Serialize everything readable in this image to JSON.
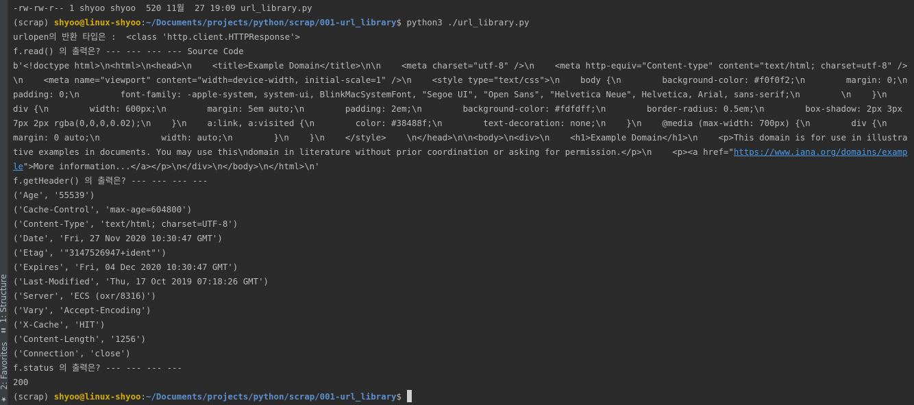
{
  "sidebar": {
    "structure_tab": "1: Structure",
    "favorites_tab": "2: Favorites"
  },
  "terminal": {
    "ls_line": "-rw-rw-r-- 1 shyoo shyoo  520 11월  27 19:09 url_library.py",
    "prompt": {
      "env": "(scrap) ",
      "user": "shyoo@linux-shyoo",
      "colon": ":",
      "path": "~/Documents/projects/python/scrap/001-url_library",
      "dollar": "$ "
    },
    "command": "python3 ./url_library.py",
    "output": {
      "return_type": "urlopen의 반환 타입은 :  <class 'http.client.HTTPResponse'>",
      "read_header": "f.read() 의 출력은? --- --- --- --- Source Code",
      "html_before_link": "b'<!doctype html>\\n<html>\\n<head>\\n    <title>Example Domain</title>\\n\\n    <meta charset=\"utf-8\" />\\n    <meta http-equiv=\"Content-type\" content=\"text/html; charset=utf-8\" />\\n    <meta name=\"viewport\" content=\"width=device-width, initial-scale=1\" />\\n    <style type=\"text/css\">\\n    body {\\n        background-color: #f0f0f2;\\n        margin: 0;\\n        padding: 0;\\n        font-family: -apple-system, system-ui, BlinkMacSystemFont, \"Segoe UI\", \"Open Sans\", \"Helvetica Neue\", Helvetica, Arial, sans-serif;\\n        \\n    }\\n    div {\\n        width: 600px;\\n        margin: 5em auto;\\n        padding: 2em;\\n        background-color: #fdfdff;\\n        border-radius: 0.5em;\\n        box-shadow: 2px 3px 7px 2px rgba(0,0,0,0.02);\\n    }\\n    a:link, a:visited {\\n        color: #38488f;\\n        text-decoration: none;\\n    }\\n    @media (max-width: 700px) {\\n        div {\\n            margin: 0 auto;\\n            width: auto;\\n        }\\n    }\\n    </style>    \\n</head>\\n\\n<body>\\n<div>\\n    <h1>Example Domain</h1>\\n    <p>This domain is for use in illustrative examples in documents. You may use this\\ndomain in literature without prior coordination or asking for permission.</p>\\n    <p><a href=\"",
      "html_link": "https://www.iana.org/domains/example",
      "html_after_link": "\">More information...</a></p>\\n</div>\\n</body>\\n</html>\\n'",
      "header_title": "f.getHeader() 의 출력은? --- --- --- ---",
      "headers": [
        "('Age', '55539')",
        "('Cache-Control', 'max-age=604800')",
        "('Content-Type', 'text/html; charset=UTF-8')",
        "('Date', 'Fri, 27 Nov 2020 10:30:47 GMT')",
        "('Etag', '\"3147526947+ident\"')",
        "('Expires', 'Fri, 04 Dec 2020 10:30:47 GMT')",
        "('Last-Modified', 'Thu, 17 Oct 2019 07:18:26 GMT')",
        "('Server', 'ECS (oxr/8316)')",
        "('Vary', 'Accept-Encoding')",
        "('X-Cache', 'HIT')",
        "('Content-Length', '1256')",
        "('Connection', 'close')"
      ],
      "status_title": "f.status 의 출력은? --- --- --- ---",
      "status_value": "200"
    }
  },
  "colors": {
    "background": "#2b2b2b",
    "text": "#bbbbbb",
    "user": "#d4ac0d",
    "path": "#5c8fcc",
    "link": "#4c9be8"
  }
}
